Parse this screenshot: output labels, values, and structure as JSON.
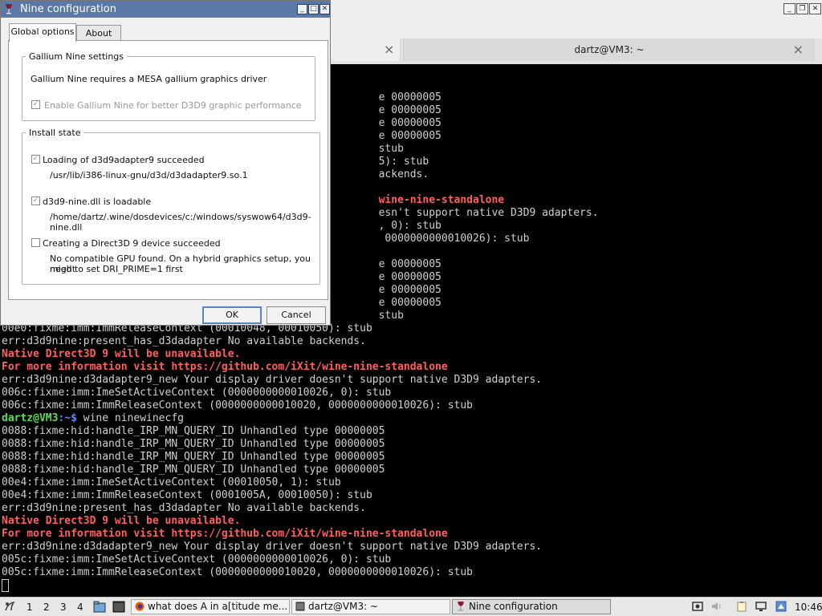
{
  "terminal": {
    "tab_active": "dartz@VM3: ~",
    "lines": [
      {
        "text": "                                                            e 00000005",
        "kind": "normal"
      },
      {
        "text": "                                                            e 00000005",
        "kind": "normal"
      },
      {
        "text": "                                                            e 00000005",
        "kind": "normal"
      },
      {
        "text": "                                                            e 00000005",
        "kind": "normal"
      },
      {
        "text": "                                                            stub",
        "kind": "normal"
      },
      {
        "text": "                                                            5): stub",
        "kind": "normal"
      },
      {
        "text": "                                                            ackends.",
        "kind": "normal"
      },
      {
        "text": "",
        "kind": "normal"
      },
      {
        "text": "                                                            wine-nine-standalone",
        "kind": "err"
      },
      {
        "text": "                                                            esn't support native D3D9 adapters.",
        "kind": "normal"
      },
      {
        "text": "                                                            , 0): stub",
        "kind": "normal"
      },
      {
        "text": "                                                             0000000000010026): stub",
        "kind": "normal"
      },
      {
        "text": "",
        "kind": "normal"
      },
      {
        "text": "                                                            e 00000005",
        "kind": "normal"
      },
      {
        "text": "                                                            e 00000005",
        "kind": "normal"
      },
      {
        "text": "                                                            e 00000005",
        "kind": "normal"
      },
      {
        "text": "                                                            e 00000005",
        "kind": "normal"
      },
      {
        "text": "                                                            stub",
        "kind": "normal"
      },
      {
        "text": "00e0:fixme:imm:ImmReleaseContext (00010048, 00010050): stub",
        "kind": "normal"
      },
      {
        "text": "err:d3d9nine:present_has_d3dadapter No available backends.",
        "kind": "normal"
      },
      {
        "text": "Native Direct3D 9 will be unavailable.",
        "kind": "err"
      },
      {
        "text": "For more information visit https://github.com/iXit/wine-nine-standalone",
        "kind": "err"
      },
      {
        "text": "err:d3d9nine:d3dadapter9_new Your display driver doesn't support native D3D9 adapters.",
        "kind": "normal"
      },
      {
        "text": "006c:fixme:imm:ImeSetActiveContext (0000000000010026, 0): stub",
        "kind": "normal"
      },
      {
        "text": "006c:fixme:imm:ImmReleaseContext (0000000000010020, 0000000000010026): stub",
        "kind": "normal"
      },
      {
        "text": "",
        "kind": "prompt"
      },
      {
        "text": "0088:fixme:hid:handle_IRP_MN_QUERY_ID Unhandled type 00000005",
        "kind": "normal"
      },
      {
        "text": "0088:fixme:hid:handle_IRP_MN_QUERY_ID Unhandled type 00000005",
        "kind": "normal"
      },
      {
        "text": "0088:fixme:hid:handle_IRP_MN_QUERY_ID Unhandled type 00000005",
        "kind": "normal"
      },
      {
        "text": "0088:fixme:hid:handle_IRP_MN_QUERY_ID Unhandled type 00000005",
        "kind": "normal"
      },
      {
        "text": "00e4:fixme:imm:ImeSetActiveContext (00010050, 1): stub",
        "kind": "normal"
      },
      {
        "text": "00e4:fixme:imm:ImmReleaseContext (0001005A, 00010050): stub",
        "kind": "normal"
      },
      {
        "text": "err:d3d9nine:present_has_d3dadapter No available backends.",
        "kind": "normal"
      },
      {
        "text": "Native Direct3D 9 will be unavailable.",
        "kind": "err"
      },
      {
        "text": "For more information visit https://github.com/iXit/wine-nine-standalone",
        "kind": "err"
      },
      {
        "text": "err:d3d9nine:d3dadapter9_new Your display driver doesn't support native D3D9 adapters.",
        "kind": "normal"
      },
      {
        "text": "005c:fixme:imm:ImeSetActiveContext (0000000000010026, 0): stub",
        "kind": "normal"
      },
      {
        "text": "005c:fixme:imm:ImmReleaseContext (0000000000010020, 0000000000010026): stub",
        "kind": "normal"
      }
    ],
    "prompt_user": "dartz@VM3",
    "prompt_path": ":~$",
    "prompt_cmd": " wine ninewinecfg"
  },
  "dialog": {
    "title": "Nine configuration",
    "tabs": [
      "Global options",
      "About"
    ],
    "gallium_group": "Gallium Nine settings",
    "gallium_req": "Gallium Nine requires a MESA gallium graphics driver",
    "enable_label": "Enable Gallium Nine for better D3D9 graphic performance",
    "install_group": "Install state",
    "load_label": "Loading of d3d9adapter9 succeeded",
    "load_path": "/usr/lib/i386-linux-gnu/d3d/d3dadapter9.so.1",
    "dll_label": "d3d9-nine.dll is loadable",
    "dll_path_1": "/home/dartz/.wine/dosdevices/c:/windows/syswow64/d3d9-",
    "dll_path_2": "nine.dll",
    "device_label": "Creating a Direct3D 9 device succeeded",
    "device_msg_1": "No compatible GPU found. On a hybrid graphics setup, you might",
    "device_msg_2": "need to set DRI_PRIME=1 first",
    "ok": "OK",
    "cancel": "Cancel"
  },
  "taskbar": {
    "workspaces": [
      "1",
      "2",
      "3",
      "4"
    ],
    "tasks": [
      "what does A in a[titude me...",
      "dartz@VM3: ~",
      "Nine configuration"
    ],
    "clock": "10:46"
  },
  "colors": {
    "titlebar": "#5a79a8",
    "terminal_bg": "#000000",
    "terminal_err": "#ff5f5f"
  }
}
